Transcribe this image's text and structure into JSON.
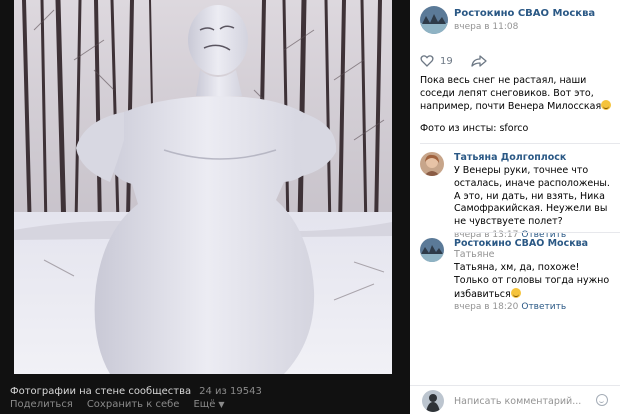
{
  "viewer": {
    "caption_label": "Фотографии на стене сообщества",
    "counter": "24 из 19543",
    "actions": [
      "Поделиться",
      "Сохранить к себе",
      "Ещё"
    ]
  },
  "post": {
    "author": "Ростокино СВАО Москва",
    "time": "вчера в 11:08",
    "likes": "19",
    "text": "Пока весь снег не растаял, наши соседи лепят снеговиков. Вот это, например, почти Венера Милосская",
    "source": "Фото из инсты: sforco"
  },
  "comments": [
    {
      "author": "Татьяна Долгоплоск",
      "text": "У Венеры руки, точнее что осталась, иначе расположены. А это, ни дать, ни взять, Ника Самофракийская. Неужели вы не чувствуете полет?",
      "time": "вчера в 13:17",
      "reply": "Ответить"
    },
    {
      "author": "Ростокино СВАО Москва",
      "addressee": "Татьяне",
      "text": "Татьяна, хм, да, похоже! Только от головы тогда нужно избавиться",
      "time": "вчера в 18:20",
      "reply": "Ответить"
    }
  ],
  "compose": {
    "placeholder": "Написать комментарий..."
  },
  "icons": [
    "heart-icon",
    "share-arrow-icon",
    "emoji-icon",
    "chevron-down-icon"
  ]
}
